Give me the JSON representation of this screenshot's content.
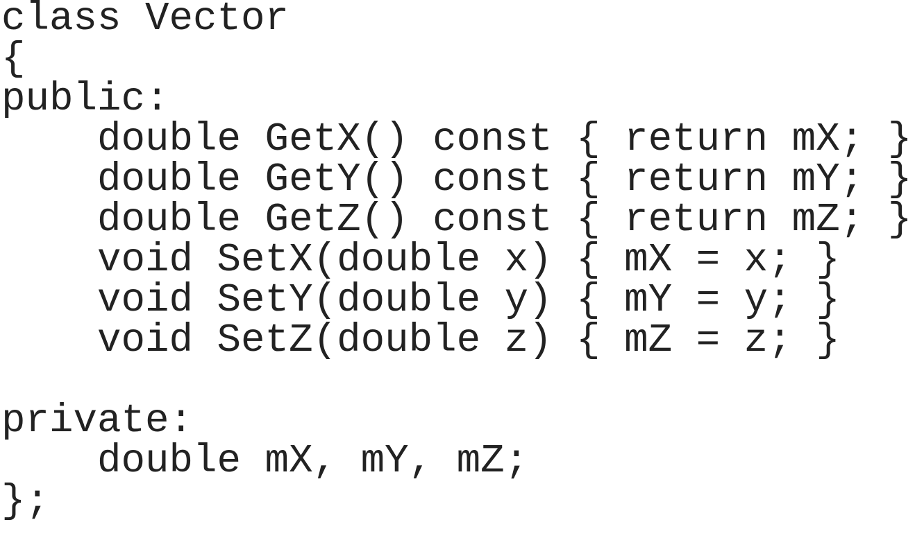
{
  "code": {
    "lines": [
      "class Vector",
      "{",
      "public:",
      "    double GetX() const { return mX; }",
      "    double GetY() const { return mY; }",
      "    double GetZ() const { return mZ; }",
      "    void SetX(double x) { mX = x; }",
      "    void SetY(double y) { mY = y; }",
      "    void SetZ(double z) { mZ = z; }",
      "",
      "private:",
      "    double mX, mY, mZ;",
      "};"
    ]
  }
}
